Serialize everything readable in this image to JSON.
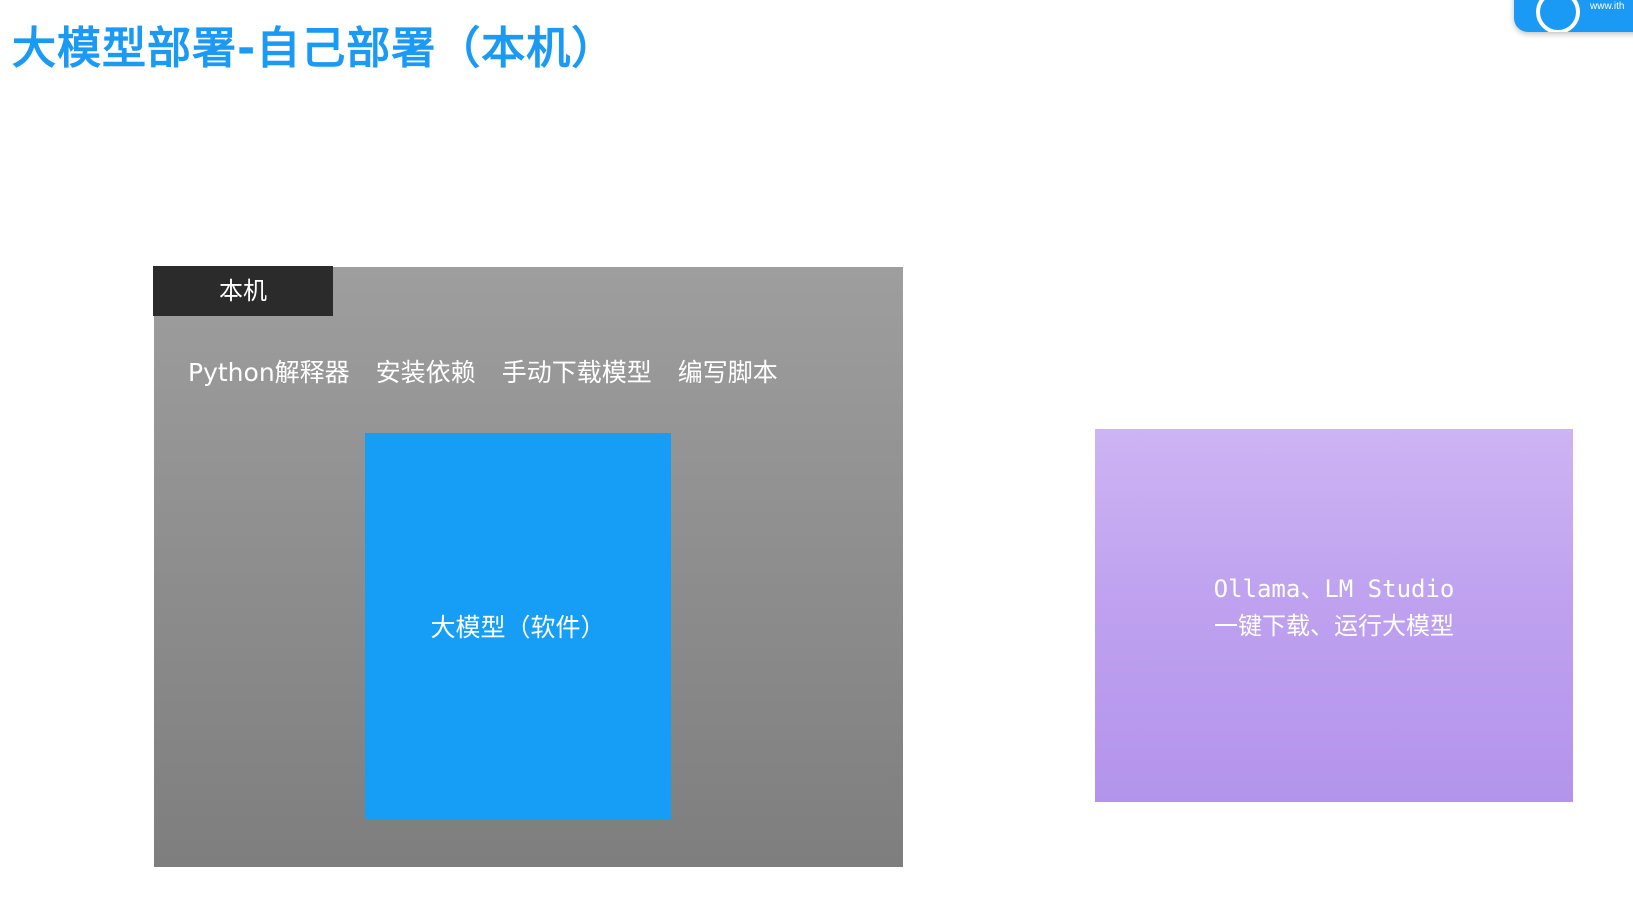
{
  "title": "大模型部署-自己部署（本机）",
  "badge": {
    "url_text": "www.ith"
  },
  "machine": {
    "tag": "本机",
    "steps": [
      "Python解释器",
      "安装依赖",
      "手动下载模型",
      "编写脚本"
    ],
    "model_label": "大模型（软件）"
  },
  "tools": {
    "line1": "Ollama、LM Studio",
    "line2": "一键下载、运行大模型"
  },
  "colors": {
    "title": "#1a9af4",
    "machine_panel": "#8c8c8c",
    "machine_tag": "#2b2b2b",
    "model_box": "#169ef7",
    "tool_panel": "#bea0ef"
  }
}
